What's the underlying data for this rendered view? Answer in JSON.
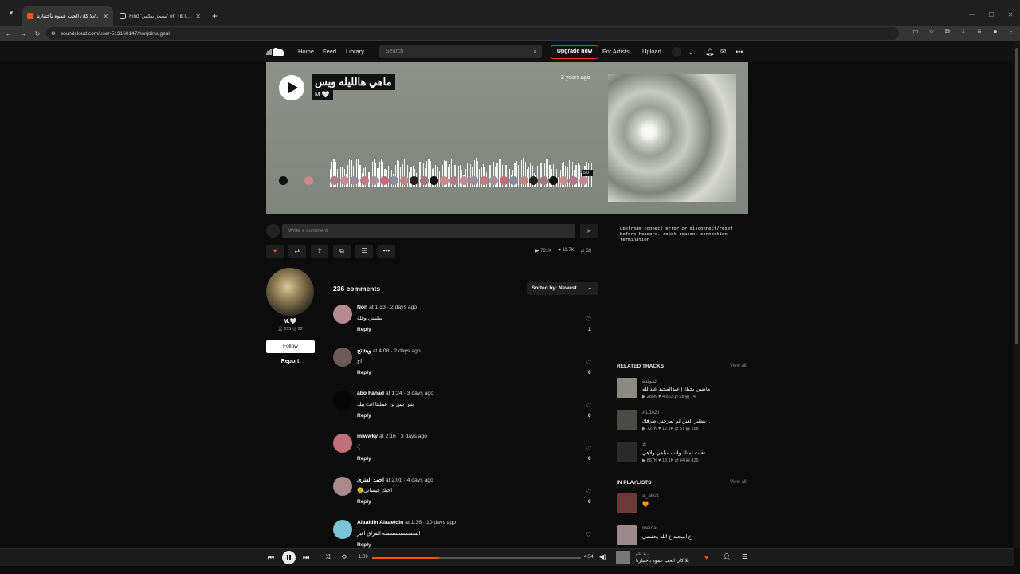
{
  "browser": {
    "tabs": [
      {
        "title": "يلا كان الحب عموه بأختيارنا/..",
        "active": true,
        "favicon_color": "#ff5500"
      },
      {
        "title": "Find 'سيمز بيكس' on TikTok | Ti",
        "active": false,
        "favicon_color": "#ffffff"
      }
    ],
    "url": "soundcloud.com/user-513160147/hwrjdiruugeul"
  },
  "header": {
    "nav": [
      "Home",
      "Feed",
      "Library"
    ],
    "search_placeholder": "Search",
    "upgrade": "Upgrade now",
    "for_artists": "For Artists",
    "upload": "Upload"
  },
  "track": {
    "title": "ماهي هالليله ويس",
    "artist": "M.🤍",
    "posted": "2 years ago",
    "duration_label": "5:07",
    "progress": 0.22
  },
  "comment_box": {
    "placeholder": "Write a comment"
  },
  "error_text": "upstream connect error or disconnect/reset before headers. reset reason: connection termination",
  "stats": {
    "plays": "721K",
    "likes": "11.7K",
    "reposts": "33"
  },
  "user": {
    "name": "M.🤍",
    "followers": "221",
    "tracks": "22",
    "follow": "Follow",
    "report": "Report"
  },
  "comments_section": {
    "count_label": "236 comments",
    "sort_label": "Sorted by: Newest",
    "reply_label": "Reply",
    "items": [
      {
        "author": "Non",
        "time": "1:33",
        "ago": "2 days ago",
        "text": "سلبيني وقلة",
        "likes": "1",
        "avatar_color": "#b58a90"
      },
      {
        "author": "ويشتح",
        "time": "4:08",
        "ago": "2 days ago",
        "text": "اح",
        "likes": "0",
        "avatar_color": "#6b5a55"
      },
      {
        "author": "abo Fahad",
        "time": "1:24",
        "ago": "3 days ago",
        "text": "بس بس لن عمليتا انت يبك",
        "likes": "0",
        "avatar_color": "#050505"
      },
      {
        "author": "miwwky",
        "time": "2:16",
        "ago": "3 days ago",
        "text": ":(",
        "likes": "0",
        "avatar_color": "#c07078"
      },
      {
        "author": "احمد العنزي",
        "time": "2:01",
        "ago": "4 days ago",
        "text": "احبك عيساني😢",
        "likes": "0",
        "avatar_color": "#a88a8a"
      },
      {
        "author": "Alaaldin Alaaeldin",
        "time": "1:36",
        "ago": "10 days ago",
        "text": "ايسسسسسسسه الفراق اقبر",
        "likes": "",
        "avatar_color": "#7cc4d8"
      }
    ]
  },
  "related": {
    "heading": "RELATED TRACKS",
    "view_all": "View all",
    "items": [
      {
        "artist": "المولدة",
        "title": "ماضين بحبك | عبدالمجيد عبدالله",
        "plays": "285K",
        "likes": "4,653",
        "reposts": "18",
        "comments": "74",
        "thumb": "#8a8a80"
      },
      {
        "artist": "ALJAZI",
        "title": "بتطير العين لم تمرحني طرفك ..",
        "plays": "727K",
        "likes": "12.9K",
        "reposts": "57",
        "comments": "158",
        "thumb": "#4a4a48"
      },
      {
        "artist": "✲",
        "title": "تعبت لمنك وانت ساهي ولاهي",
        "plays": "867K",
        "likes": "13.1K",
        "reposts": "64",
        "comments": "426",
        "thumb": "#2a2a2a"
      }
    ]
  },
  "playlists": {
    "heading": "IN PLAYLISTS",
    "view_all": "View all",
    "items": [
      {
        "artist": "a_alis3",
        "title": "🧡",
        "thumb": "#6a3a3a"
      },
      {
        "artist": "meina",
        "title": "ع المجيد ع الله يحفضي",
        "thumb": "#9a8a8a"
      }
    ]
  },
  "player": {
    "current": "1:09",
    "total": "4:54",
    "progress": 0.32,
    "artist": "يلا كانو..",
    "title": "يلا كان الحب عموه بأختيارنا"
  },
  "colors": {
    "accent": "#ff5500",
    "upgrade_border": "#e8332a"
  }
}
